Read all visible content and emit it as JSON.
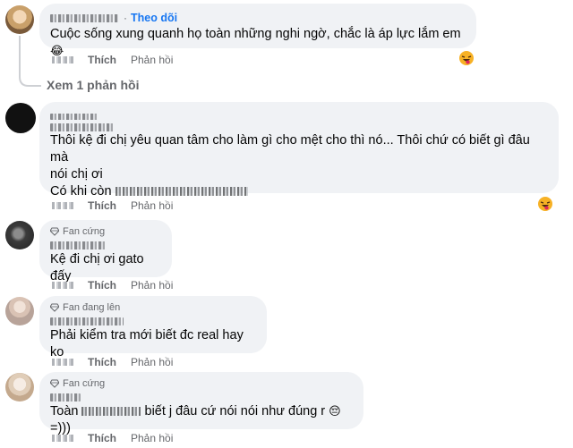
{
  "colors": {
    "link_blue": "#1877f2",
    "bubble_bg": "#f0f2f5",
    "secondary_text": "#65676b"
  },
  "comment1": {
    "follow_label": "Theo dõi",
    "text": "Cuộc sống xung quanh họ toàn những nghi ngờ, chắc là áp lực lắm em",
    "emoji": "😂",
    "like_label": "Thích",
    "reply_label": "Phản hồi",
    "reaction_icon": "laughing-tongue-emoji"
  },
  "view_replies": {
    "label": "Xem 1 phản hồi"
  },
  "comment2": {
    "line1": "Thôi kệ đi chị yêu quan tâm cho làm gì cho mệt cho thì nó... Thôi chứ có biết gì đâu mà",
    "line2": "nói chị ơi",
    "line3_prefix": "Có khi còn",
    "like_label": "Thích",
    "reply_label": "Phản hồi",
    "reaction_icon": "laughing-tongue-emoji"
  },
  "comment3": {
    "badge": "Fan cứng",
    "text": "Kệ đi chị ơi gato đấy",
    "like_label": "Thích",
    "reply_label": "Phản hồi"
  },
  "comment4": {
    "badge": "Fan đang lên",
    "text": "Phải kiểm tra mới biết đc real hay ko",
    "like_label": "Thích",
    "reply_label": "Phản hồi"
  },
  "comment5": {
    "badge": "Fan cứng",
    "text_prefix": "Toàn",
    "text_suffix": "biết j đâu cứ nói nói như đúng r",
    "emoji": "😔",
    "text_end": "=)))",
    "like_label": "Thích",
    "reply_label": "Phản hồi"
  }
}
